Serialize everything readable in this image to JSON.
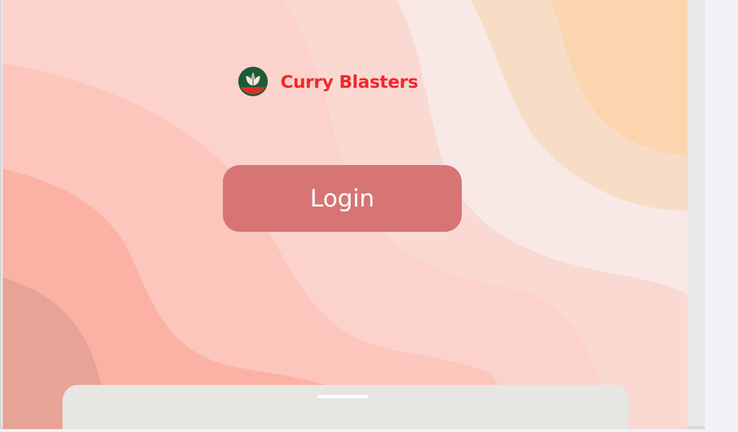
{
  "app": {
    "brand_name": "Curry Blasters",
    "logo_icon": "leaf-logo-icon"
  },
  "login": {
    "label": "Login"
  },
  "sheet": {
    "handle_icon": "drag-handle-icon"
  },
  "colors": {
    "brand_red": "#f1282a",
    "login_button": "#d77575",
    "logo_green": "#1e5a37",
    "sheet_bg": "#e8e6e3",
    "bg_peach_light": "#f8e9e6",
    "bg_orange": "#fcd4ae",
    "bg_pink": "#fcc9bf",
    "bg_salmon": "#fbb2a4",
    "bg_deep": "#e8a397"
  }
}
